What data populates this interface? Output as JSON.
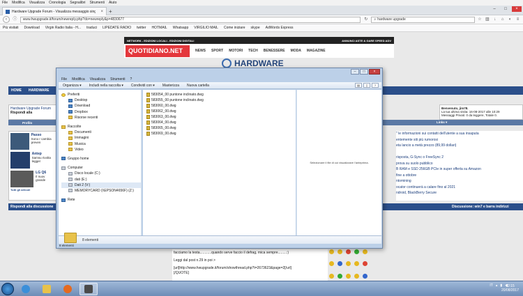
{
  "browser": {
    "menu": [
      "File",
      "Modifica",
      "Visualizza",
      "Cronologia",
      "Segnalibri",
      "Strumenti",
      "Aiuto"
    ],
    "tab_title": "Hardware Upgrade Forum - Visualizza messaggio singolo - win7 e ...",
    "url": "www.hwupgrade.it/forum/newreply.php?do=newreply&p=4830677",
    "search_value": "hardware upgrade",
    "bookmarks": [
      "Più visitati",
      "Download",
      "Virgin Radio Italia - H...",
      "traduci",
      "LIPEDATE RADIO",
      "twitter",
      "HOTMAIL",
      "Whatsapp",
      "VIRGILIO MAIL",
      "Come iniziare",
      "skype",
      "AdWords Express"
    ]
  },
  "site": {
    "banner_left": "NETWORK - EDIZIONI LOCALI - EDIZIONI DIGITALI",
    "banner_right": "ANNUNCI ASTE & GARE SPEED ADV",
    "qn_logo": "QUOTIDIANO.NET",
    "qn_nav": [
      "NEWS",
      "SPORT",
      "MOTORI",
      "TECH",
      "BENESSERE",
      "MODA",
      "MAGAZINE"
    ],
    "logo": "HARDWARE",
    "forum_nav": [
      "HOME",
      "HARDWARE",
      "NE"
    ],
    "crumb_line1": "Hardware Upgrade Forum",
    "crumb_line2": "Rispondi alla",
    "welcome_line1": "Benvenuto, jim78.",
    "welcome_line2": "La tua ultima visita: 16-08-2017 alle 10:29",
    "welcome_line3": "Messaggi Privati: 0 da leggere, Totale 0.",
    "profile_label": "Profilo",
    "links_label": "Links ▾",
    "news_items": [
      {
        "title": "Passo",
        "text": "Sono r cambia preven"
      },
      {
        "title": "Antep",
        "text": "Samsu rivolta legger"
      },
      {
        "title": "LG Q6",
        "text": "Il nuov grande"
      }
    ],
    "all_news": "Tutti gli articoli",
    "right_news": [
      "\" le informazioni sui contatti dell'utente a sua insaputa",
      "entemente siti più rumorosi",
      "eta lancio a metà prezzo (89,99 dollari)",
      "",
      "risposta, G-Sync o FreeSync 2",
      "prova su suolo pubblico",
      "B RAM e SSD 256GB PCIe in super offerta su Amazon",
      "fine a ottobre",
      "ntomining",
      "ocator continuerà a calare fino al 2021",
      "ndroid, BlackBerry Secure"
    ],
    "reply_label": "Rispondi alla discussione",
    "discussion_label": "Discussione: win7 e barra indirizzi",
    "editor_line1": "facciamo la testa............quando serve faccio il defrag, mica sempre.........:)",
    "editor_line2": "Leggi dal post n.29 in poi >",
    "editor_line3": "[url]http://www.hwupgrade.it/forum/showthread.php?t=2673623&page=2[/url]",
    "editor_line4": "[/QUOTE]"
  },
  "explorer": {
    "menu": [
      "File",
      "Modifica",
      "Visualizza",
      "Strumenti",
      "?"
    ],
    "toolbar": [
      "Organizza ▾",
      "Includi nella raccolta ▾",
      "Condividi con ▾",
      "Masterizza",
      "Nuova cartella"
    ],
    "nav": {
      "favorites_label": "Preferiti",
      "favorites": [
        "Desktop",
        "Download",
        "Dropbox",
        "Risorse recenti"
      ],
      "libraries_label": "Raccolte",
      "libraries": [
        "Documenti",
        "Immagini",
        "Musica",
        "Video"
      ],
      "homegroup_label": "Gruppo home",
      "computer_label": "Computer",
      "drives": [
        "Disco locale (C:)",
        "dati (E:)",
        "Dati 2 (V:)",
        "MEMORYCARD (\\\\EPSON4656F) (Z:)"
      ],
      "network_label": "Rete"
    },
    "files": [
      "583054_00 puntone inclinato.dwg",
      "583055_00 puntone inclinato.dwg",
      "583060_00.dwg",
      "583062_00.dwg",
      "583063_00.dwg",
      "583064_00.dwg",
      "583065_00.dwg",
      "583069_00.dwg"
    ],
    "preview_text": "Selezionare il file di cui visualizzare l'anteprima.",
    "details_count": "8 elementi",
    "status": "8 elementi"
  },
  "taskbar": {
    "tray_lang": "IT",
    "time": "12:15",
    "date": "20/08/2017"
  }
}
